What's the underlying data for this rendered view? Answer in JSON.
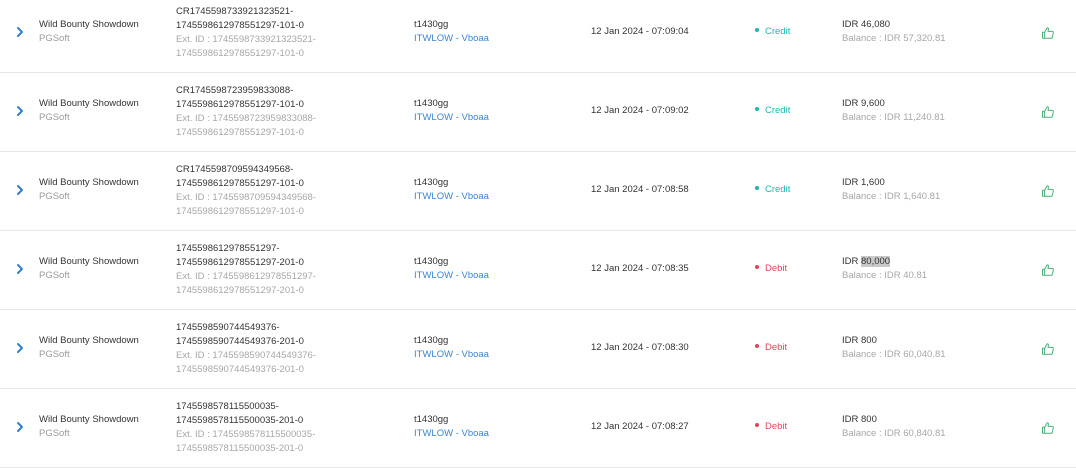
{
  "rows": [
    {
      "game": "Wild Bounty Showdown",
      "provider": "PGSoft",
      "id_line1": "CR1745598733921323521-",
      "id_line2": "1745598612978551297-101-0",
      "ext_line1": "Ext. ID : 1745598733921323521-",
      "ext_line2": "1745598612978551297-101-0",
      "user": "t1430gg",
      "user_link": "ITWLOW - Vboaa",
      "date": "12 Jan 2024 - 07:09:04",
      "type": "Credit",
      "amount_prefix": "IDR ",
      "amount_value": "46,080",
      "balance": "Balance : IDR 57,320.81"
    },
    {
      "game": "Wild Bounty Showdown",
      "provider": "PGSoft",
      "id_line1": "CR1745598723959833088-",
      "id_line2": "1745598612978551297-101-0",
      "ext_line1": "Ext. ID : 1745598723959833088-",
      "ext_line2": "1745598612978551297-101-0",
      "user": "t1430gg",
      "user_link": "ITWLOW - Vboaa",
      "date": "12 Jan 2024 - 07:09:02",
      "type": "Credit",
      "amount_prefix": "IDR ",
      "amount_value": "9,600",
      "balance": "Balance : IDR 11,240.81"
    },
    {
      "game": "Wild Bounty Showdown",
      "provider": "PGSoft",
      "id_line1": "CR1745598709594349568-",
      "id_line2": "1745598612978551297-101-0",
      "ext_line1": "Ext. ID : 1745598709594349568-",
      "ext_line2": "1745598612978551297-101-0",
      "user": "t1430gg",
      "user_link": "ITWLOW - Vboaa",
      "date": "12 Jan 2024 - 07:08:58",
      "type": "Credit",
      "amount_prefix": "IDR ",
      "amount_value": "1,600",
      "balance": "Balance : IDR 1,640.81"
    },
    {
      "game": "Wild Bounty Showdown",
      "provider": "PGSoft",
      "id_line1": "1745598612978551297-",
      "id_line2": "1745598612978551297-201-0",
      "ext_line1": "Ext. ID : 1745598612978551297-",
      "ext_line2": "1745598612978551297-201-0",
      "user": "t1430gg",
      "user_link": "ITWLOW - Vboaa",
      "date": "12 Jan 2024 - 07:08:35",
      "type": "Debit",
      "amount_prefix": "IDR ",
      "amount_value": "80,000",
      "balance": "Balance : IDR 40.81",
      "highlight": true
    },
    {
      "game": "Wild Bounty Showdown",
      "provider": "PGSoft",
      "id_line1": "1745598590744549376-",
      "id_line2": "1745598590744549376-201-0",
      "ext_line1": "Ext. ID : 1745598590744549376-",
      "ext_line2": "1745598590744549376-201-0",
      "user": "t1430gg",
      "user_link": "ITWLOW - Vboaa",
      "date": "12 Jan 2024 - 07:08:30",
      "type": "Debit",
      "amount_prefix": "IDR ",
      "amount_value": "800",
      "balance": "Balance : IDR 60,040.81"
    },
    {
      "game": "Wild Bounty Showdown",
      "provider": "PGSoft",
      "id_line1": "1745598578115500035-",
      "id_line2": "1745598578115500035-201-0",
      "ext_line1": "Ext. ID : 1745598578115500035-",
      "ext_line2": "1745598578115500035-201-0",
      "user": "t1430gg",
      "user_link": "ITWLOW - Vboaa",
      "date": "12 Jan 2024 - 07:08:27",
      "type": "Debit",
      "amount_prefix": "IDR ",
      "amount_value": "800",
      "balance": "Balance : IDR 60,840.81"
    }
  ],
  "icons": {
    "expand": "chevron-right-icon",
    "like": "thumbs-up-icon"
  },
  "colors": {
    "credit": "#1fb6ad",
    "debit": "#e0465c",
    "link": "#3a86d4",
    "chevron": "#2f80d0",
    "like": "#4caf79"
  }
}
